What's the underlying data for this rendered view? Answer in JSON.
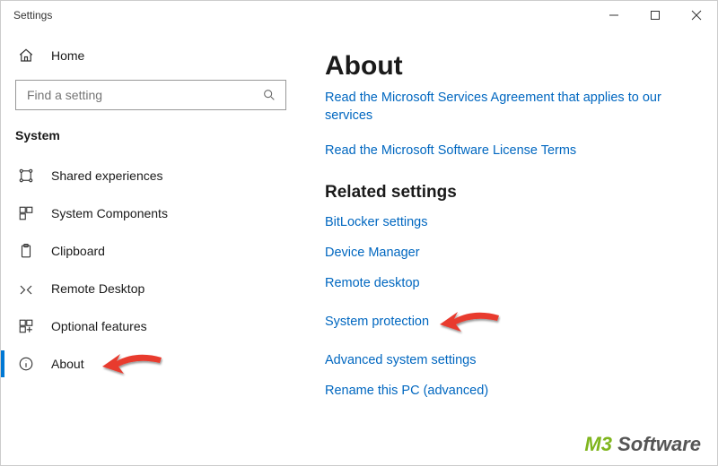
{
  "window": {
    "title": "Settings"
  },
  "sidebar": {
    "home": "Home",
    "search_placeholder": "Find a setting",
    "category": "System",
    "items": [
      {
        "label": "Shared experiences"
      },
      {
        "label": "System Components"
      },
      {
        "label": "Clipboard"
      },
      {
        "label": "Remote Desktop"
      },
      {
        "label": "Optional features"
      },
      {
        "label": "About"
      }
    ]
  },
  "main": {
    "title": "About",
    "link_services": "Read the Microsoft Services Agreement that applies to our services",
    "link_license": "Read the Microsoft Software License Terms",
    "related_heading": "Related settings",
    "related": [
      "BitLocker settings",
      "Device Manager",
      "Remote desktop",
      "System protection",
      "Advanced system settings",
      "Rename this PC (advanced)"
    ]
  },
  "watermark": {
    "m3": "M3",
    "rest": "Software"
  }
}
